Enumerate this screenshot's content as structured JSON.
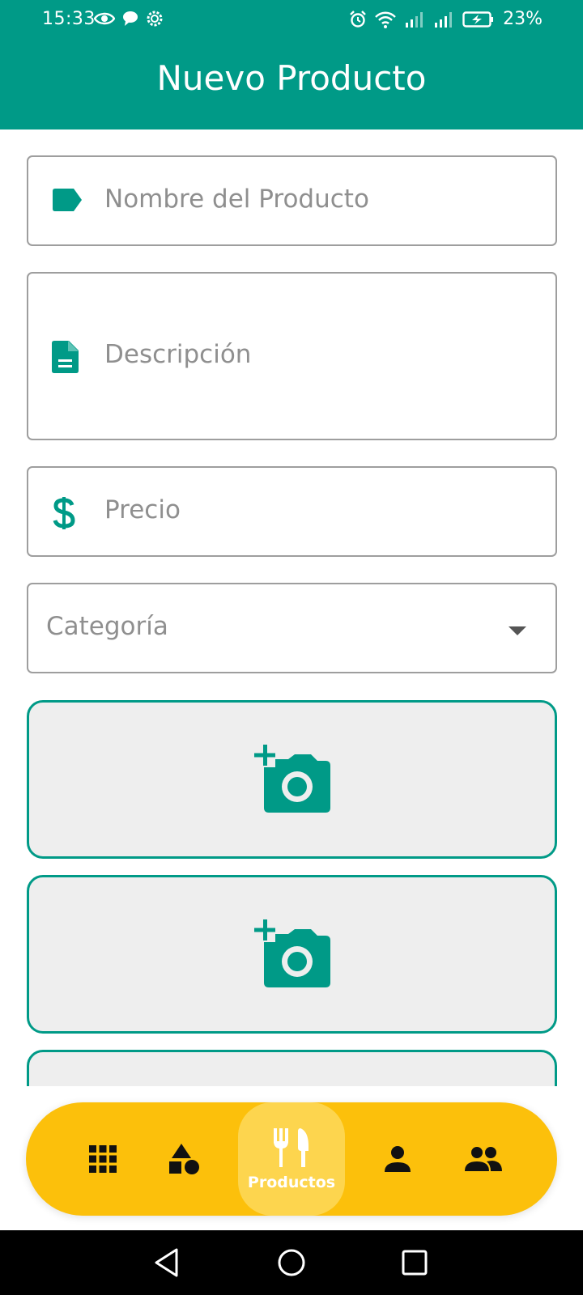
{
  "status_bar": {
    "time": "15:33",
    "battery": "23%"
  },
  "app_bar": {
    "title": "Nuevo Producto"
  },
  "form": {
    "name_placeholder": "Nombre del Producto",
    "description_placeholder": "Descripción",
    "price_placeholder": "Precio",
    "category_placeholder": "Categoría"
  },
  "photos": [
    {
      "icon": "add-photo-icon"
    },
    {
      "icon": "add-photo-icon"
    },
    {
      "icon": "add-photo-icon"
    }
  ],
  "bottom_nav": {
    "items": [
      {
        "icon": "grid-icon"
      },
      {
        "icon": "shapes-icon"
      },
      {
        "icon": "restaurant-icon",
        "label": "Productos",
        "selected": true
      },
      {
        "icon": "person-icon"
      },
      {
        "icon": "group-icon"
      }
    ]
  },
  "colors": {
    "primary": "#009a87",
    "accent": "#fcc00b",
    "photo_bg": "#eeeeee"
  }
}
